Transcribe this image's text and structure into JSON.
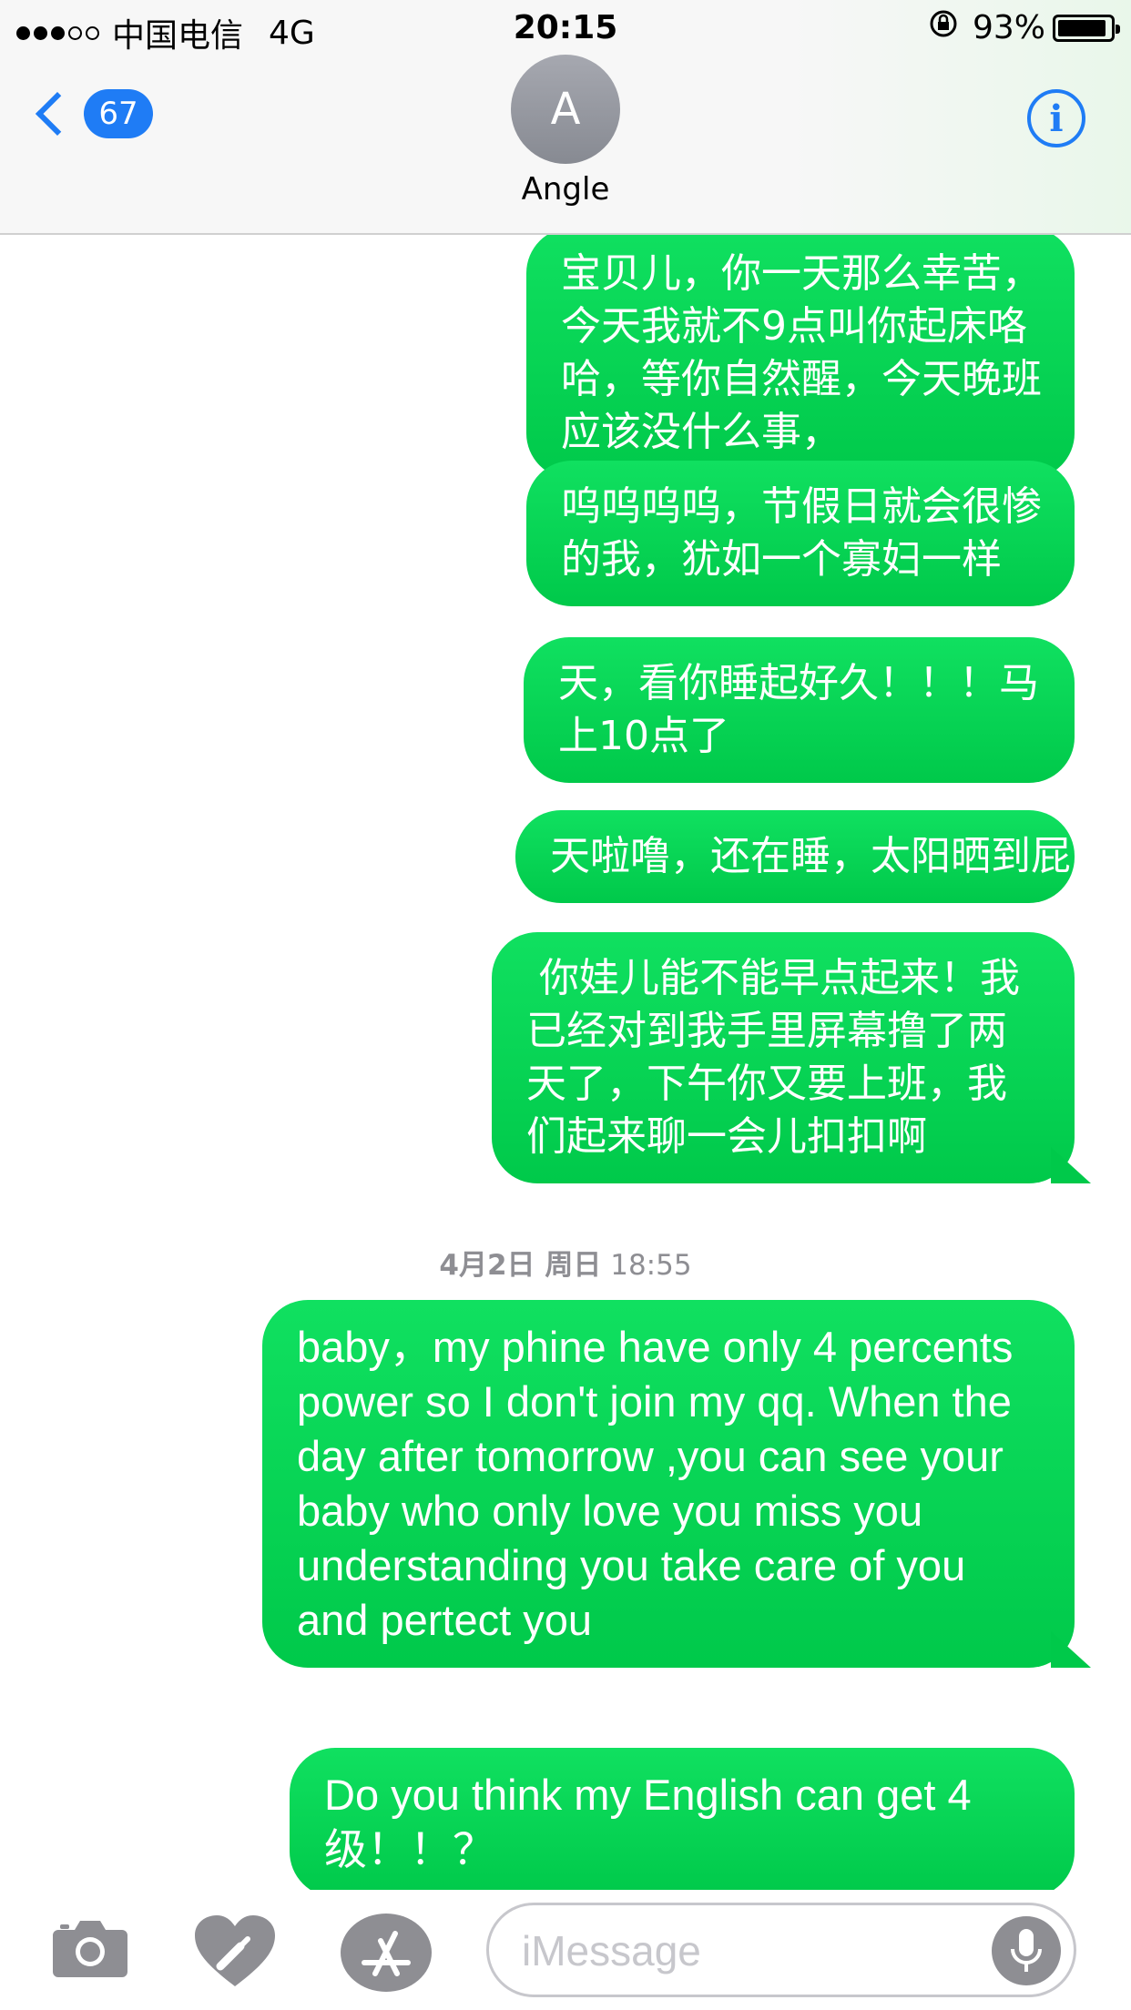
{
  "status_bar": {
    "carrier": "中国电信",
    "network": "4G",
    "time": "20:15",
    "battery": "93%",
    "battery_level": 0.93,
    "signal_bars": 3
  },
  "header": {
    "back_count": "67",
    "avatar_initial": "A",
    "contact_name": "Angle",
    "info_glyph": "i"
  },
  "messages": [
    {
      "text": "宝贝儿，你一天那么幸苦，今天我就不9点叫你起床咯哈，等你自然醒，今天晚班应该没什么事，",
      "sender": "me"
    },
    {
      "text": "呜呜呜呜，节假日就会很惨的我，犹如一个寡妇一样",
      "sender": "me"
    },
    {
      "text": "天，看你睡起好久！！！马上10点了",
      "sender": "me"
    },
    {
      "text": "天啦噜，还在睡，太阳晒到屁股了",
      "sender": "me"
    },
    {
      "text": " 你娃儿能不能早点起来！我已经对到我手里屏幕撸了两天了，下午你又要上班，我们起来聊一会儿扣扣啊",
      "sender": "me"
    },
    {
      "text": "baby，my phine have only 4 percents power so I don't join my qq. When the day after tomorrow ,you can see your baby who only love you miss you understanding you take care of you and pertect you",
      "sender": "me"
    },
    {
      "text": "Do you think my English can get 4级！！？",
      "sender": "me"
    }
  ],
  "timestamp": {
    "date": "4月2日 周日",
    "time": "18:55"
  },
  "input_bar": {
    "placeholder": "iMessage",
    "icons": [
      "camera-icon",
      "digital-touch-heart-icon",
      "app-store-icon",
      "microphone-icon"
    ]
  },
  "colors": {
    "bubble_green": "#00c94a",
    "accent_blue": "#1f7cf5",
    "timestamp_gray": "#8e8e93"
  }
}
